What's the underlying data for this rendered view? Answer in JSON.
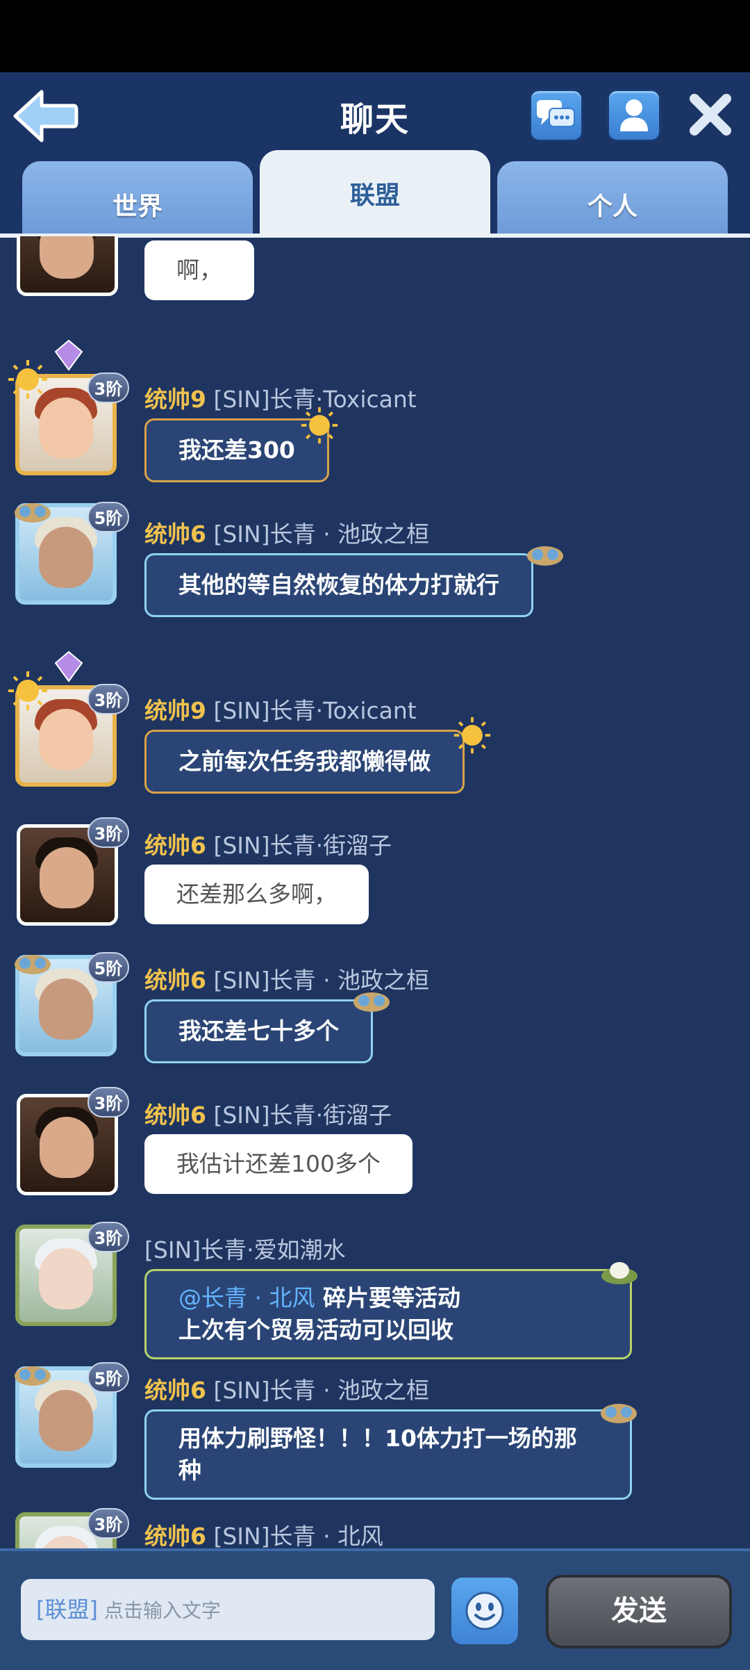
{
  "header": {
    "title": "聊天",
    "tabs": [
      {
        "label": "世界",
        "active": false
      },
      {
        "label": "联盟",
        "active": true
      },
      {
        "label": "个人",
        "active": false
      }
    ]
  },
  "messages": [
    {
      "level": "",
      "sender": "",
      "rank": "",
      "text": "啊，",
      "style": "white"
    },
    {
      "level": "统帅9",
      "sender": "[SIN]长青·Toxicant",
      "rank": "3阶",
      "text": "我还差300",
      "style": "gold"
    },
    {
      "level": "统帅6",
      "sender": "[SIN]长青 · 池政之桓",
      "rank": "5阶",
      "text": "其他的等自然恢复的体力打就行",
      "style": "ice"
    },
    {
      "level": "统帅9",
      "sender": "[SIN]长青·Toxicant",
      "rank": "3阶",
      "text": "之前每次任务我都懒得做",
      "style": "gold"
    },
    {
      "level": "统帅6",
      "sender": "[SIN]长青·街溜子",
      "rank": "3阶",
      "text": "还差那么多啊，",
      "style": "white"
    },
    {
      "level": "统帅6",
      "sender": "[SIN]长青 · 池政之桓",
      "rank": "5阶",
      "text": "我还差七十多个",
      "style": "ice"
    },
    {
      "level": "统帅6",
      "sender": "[SIN]长青·街溜子",
      "rank": "3阶",
      "text": "我估计还差100多个",
      "style": "white"
    },
    {
      "level": "",
      "sender": "[SIN]长青·爱如潮水",
      "rank": "3阶",
      "mention": "@长青 · 北风",
      "text": "碎片要等活动",
      "text2": "上次有个贸易活动可以回收",
      "style": "green"
    },
    {
      "level": "统帅6",
      "sender": "[SIN]长青 · 池政之桓",
      "rank": "5阶",
      "text": "用体力刷野怪！！！10体力打一场的那",
      "text2": "种",
      "style": "ice"
    },
    {
      "level": "统帅6",
      "sender": "[SIN]长青 · 北风",
      "rank": "3阶"
    }
  ],
  "input": {
    "channel_tag": "[联盟]",
    "placeholder": "点击输入文字"
  },
  "send_label": "发送",
  "colors": {
    "background": "#1f3560",
    "level_text": "#f0c24e",
    "mention": "#63b4ff"
  }
}
